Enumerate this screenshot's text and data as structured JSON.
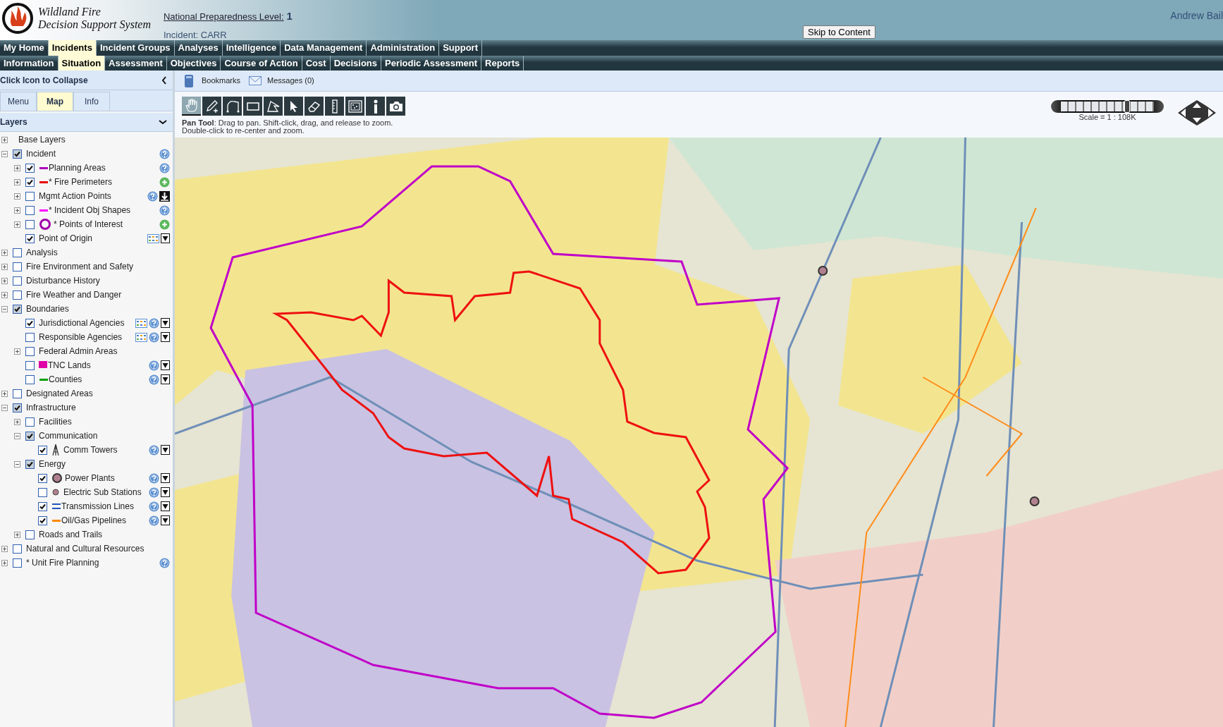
{
  "header": {
    "logo_title": [
      "Wildland Fire",
      "Decision Support System"
    ],
    "preparedness_label": "National Preparedness Level:",
    "preparedness_value": "1",
    "incident": "Incident: CARR",
    "skip_button": "Skip to Content",
    "user": "Andrew Bail"
  },
  "main_menu": [
    {
      "label": "My Home",
      "selected": false
    },
    {
      "label": "Incidents",
      "selected": true
    },
    {
      "label": "Incident Groups",
      "selected": false
    },
    {
      "label": "Analyses",
      "selected": false
    },
    {
      "label": "Intelligence",
      "selected": false
    },
    {
      "label": "Data Management",
      "selected": false
    },
    {
      "label": "Administration",
      "selected": false
    },
    {
      "label": "Support",
      "selected": false
    }
  ],
  "sub_menu": [
    {
      "label": "Information",
      "selected": false
    },
    {
      "label": "Situation",
      "selected": true
    },
    {
      "label": "Assessment",
      "selected": false
    },
    {
      "label": "Objectives",
      "selected": false
    },
    {
      "label": "Course of Action",
      "selected": false
    },
    {
      "label": "Cost",
      "selected": false
    },
    {
      "label": "Decisions",
      "selected": false
    },
    {
      "label": "Periodic Assessment",
      "selected": false
    },
    {
      "label": "Reports",
      "selected": false
    }
  ],
  "sidebar": {
    "collapse_label": "Click Icon to Collapse",
    "tabs": [
      {
        "label": "Menu",
        "selected": false
      },
      {
        "label": "Map",
        "selected": true
      },
      {
        "label": "Info",
        "selected": false
      }
    ],
    "section": "Layers",
    "layers": [
      {
        "label": "Base Layers",
        "expanded": false
      },
      {
        "label": "Incident",
        "checked": true,
        "expanded": true,
        "tools": [
          {
            "kind": "help"
          }
        ],
        "children": [
          {
            "label": "Planning Areas",
            "checked": true,
            "expanded": false,
            "legend": {
              "kind": "line",
              "color": "#b000b8"
            },
            "tools": [
              {
                "kind": "help"
              }
            ]
          },
          {
            "label": "* Fire Perimeters",
            "checked": true,
            "expanded": false,
            "legend": {
              "kind": "line",
              "color": "#e80000"
            },
            "tools": [
              {
                "kind": "add"
              }
            ]
          },
          {
            "label": "Mgmt Action Points",
            "checked": false,
            "expanded": false,
            "tools": [
              {
                "kind": "help"
              },
              {
                "kind": "download"
              }
            ]
          },
          {
            "label": "* Incident Obj Shapes",
            "checked": false,
            "expanded": false,
            "legend": {
              "kind": "line",
              "color": "#ff00ff"
            },
            "tools": [
              {
                "kind": "help"
              }
            ]
          },
          {
            "label": "* Points of Interest",
            "checked": false,
            "expanded": false,
            "legend": {
              "kind": "ring",
              "color": "#a000a8"
            },
            "tools": [
              {
                "kind": "add"
              }
            ]
          },
          {
            "label": "Point of Origin",
            "checked": true,
            "tools": [
              {
                "kind": "table"
              },
              {
                "kind": "filter"
              }
            ]
          }
        ]
      },
      {
        "label": "Analysis",
        "checked": false,
        "expanded": false
      },
      {
        "label": "Fire Environment and Safety",
        "checked": false,
        "expanded": false
      },
      {
        "label": "Disturbance History",
        "checked": false,
        "expanded": false
      },
      {
        "label": "Fire Weather and Danger",
        "checked": false,
        "expanded": false
      },
      {
        "label": "Boundaries",
        "checked": true,
        "expanded": true,
        "children": [
          {
            "label": "Jurisdictional Agencies",
            "checked": true,
            "tools": [
              {
                "kind": "table"
              },
              {
                "kind": "help"
              },
              {
                "kind": "filter"
              }
            ]
          },
          {
            "label": "Responsible Agencies",
            "checked": false,
            "tools": [
              {
                "kind": "table"
              },
              {
                "kind": "help"
              },
              {
                "kind": "filter"
              }
            ]
          },
          {
            "label": "Federal Admin Areas",
            "checked": false,
            "expanded": false
          },
          {
            "label": "TNC Lands",
            "checked": false,
            "legend": {
              "kind": "square",
              "color": "#e000a8"
            },
            "tools": [
              {
                "kind": "help"
              },
              {
                "kind": "filter"
              }
            ]
          },
          {
            "label": "Counties",
            "checked": false,
            "legend": {
              "kind": "line",
              "color": "#00a000"
            },
            "tools": [
              {
                "kind": "help"
              },
              {
                "kind": "filter"
              }
            ]
          }
        ]
      },
      {
        "label": "Designated Areas",
        "checked": false,
        "expanded": false
      },
      {
        "label": "Infrastructure",
        "checked": true,
        "expanded": true,
        "children": [
          {
            "label": "Facilities",
            "checked": false,
            "expanded": false
          },
          {
            "label": "Communication",
            "checked": true,
            "expanded": true,
            "children": [
              {
                "label": "Comm Towers",
                "checked": true,
                "legend": {
                  "kind": "tower"
                },
                "tools": [
                  {
                    "kind": "help"
                  },
                  {
                    "kind": "filter"
                  }
                ]
              }
            ]
          },
          {
            "label": "Energy",
            "checked": true,
            "expanded": true,
            "children": [
              {
                "label": "Power Plants",
                "checked": true,
                "legend": {
                  "kind": "big-dot",
                  "color": "#b0808e"
                },
                "tools": [
                  {
                    "kind": "help"
                  },
                  {
                    "kind": "filter"
                  }
                ]
              },
              {
                "label": "Electric Sub Stations",
                "checked": false,
                "legend": {
                  "kind": "dot",
                  "color": "#b0808e"
                },
                "tools": [
                  {
                    "kind": "help"
                  },
                  {
                    "kind": "filter"
                  }
                ]
              },
              {
                "label": "Transmission Lines",
                "checked": true,
                "legend": {
                  "kind": "double-line",
                  "color": "#2255bb"
                },
                "tools": [
                  {
                    "kind": "help"
                  },
                  {
                    "kind": "filter"
                  }
                ]
              },
              {
                "label": "Oil/Gas Pipelines",
                "checked": true,
                "legend": {
                  "kind": "line",
                  "color": "#ff8800"
                },
                "tools": [
                  {
                    "kind": "help"
                  },
                  {
                    "kind": "filter"
                  }
                ]
              }
            ]
          },
          {
            "label": "Roads and Trails",
            "checked": false,
            "expanded": false
          }
        ]
      },
      {
        "label": "Natural and Cultural Resources",
        "checked": false,
        "expanded": false
      },
      {
        "label": "* Unit Fire Planning",
        "checked": false,
        "expanded": false,
        "tools": [
          {
            "kind": "help"
          }
        ]
      }
    ]
  },
  "toolbar": {
    "links": [
      {
        "kind": "bookmarks",
        "label": "Bookmarks"
      },
      {
        "kind": "messages",
        "label": "Messages (0)"
      }
    ],
    "tools": [
      {
        "kind": "pan",
        "selected": true
      },
      {
        "kind": "draw",
        "selected": false
      },
      {
        "kind": "line",
        "selected": false
      },
      {
        "kind": "rectangle",
        "selected": false
      },
      {
        "kind": "polygon",
        "selected": false
      },
      {
        "kind": "select",
        "selected": false
      },
      {
        "kind": "erase",
        "selected": false
      },
      {
        "kind": "measure",
        "selected": false
      },
      {
        "kind": "area",
        "selected": false
      },
      {
        "kind": "info",
        "selected": false
      },
      {
        "kind": "camera",
        "selected": false
      }
    ],
    "hint": [
      "**Pan Tool**: Drag to pan. Shift-click, drag, and release to zoom.",
      "Double-click to re-center and zoom."
    ]
  },
  "map": {
    "kind": "picture",
    "zoom": {
      "level": 0.71,
      "scale": "Scale = 1 : 108K"
    }
  }
}
